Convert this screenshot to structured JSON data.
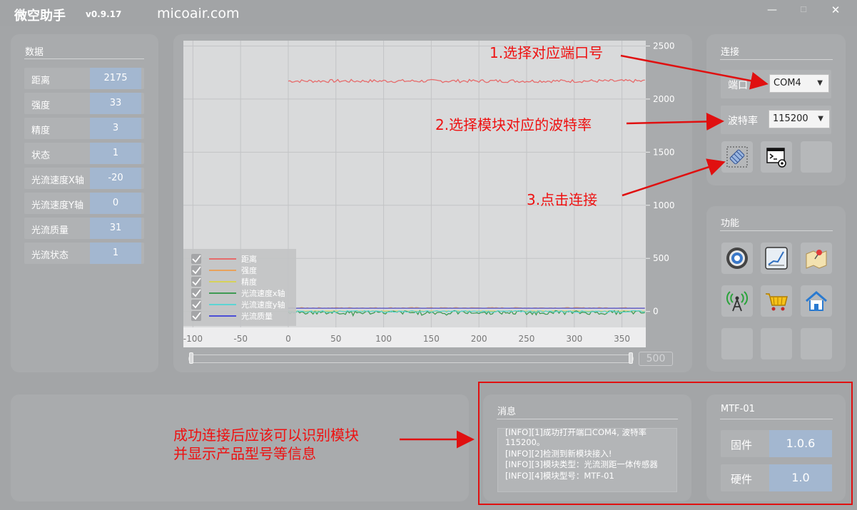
{
  "titlebar": {
    "app_name": "微空助手",
    "version": "v0.9.17",
    "site": "micoair.com",
    "min": "—",
    "max": "☐",
    "close": "✕"
  },
  "data_panel": {
    "title": "数据",
    "rows": [
      {
        "label": "距离",
        "value": "2175"
      },
      {
        "label": "强度",
        "value": "33"
      },
      {
        "label": "精度",
        "value": "3"
      },
      {
        "label": "状态",
        "value": "1"
      },
      {
        "label": "光流速度X轴",
        "value": "-20"
      },
      {
        "label": "光流速度Y轴",
        "value": "0"
      },
      {
        "label": "光流质量",
        "value": "31"
      },
      {
        "label": "光流状态",
        "value": "1"
      }
    ]
  },
  "chart": {
    "slider_value": "500"
  },
  "chart_data": {
    "type": "line",
    "x_ticks": [
      -100,
      -50,
      0,
      50,
      100,
      150,
      200,
      250,
      300,
      350
    ],
    "y_ticks": [
      0,
      500,
      1000,
      1500,
      2000,
      2500
    ],
    "xlim": [
      -110,
      375
    ],
    "ylim": [
      -150,
      2550
    ],
    "grid": true,
    "legend_position": "bottom-left",
    "series": [
      {
        "name": "距离",
        "color": "#e66b6b",
        "x_range": [
          0,
          375
        ],
        "level": 2170,
        "noise": 15
      },
      {
        "name": "强度",
        "color": "#e8a25b",
        "x_range": [
          0,
          375
        ],
        "level": 33,
        "noise": 4
      },
      {
        "name": "精度",
        "color": "#d6d25a",
        "x_range": [
          0,
          375
        ],
        "level": 3,
        "noise": 2
      },
      {
        "name": "光流速度x轴",
        "color": "#3f9a53",
        "x_range": [
          0,
          375
        ],
        "level": -10,
        "noise": 18
      },
      {
        "name": "光流速度y轴",
        "color": "#5cd4d4",
        "x_range": [
          0,
          375
        ],
        "level": 0,
        "noise": 8
      },
      {
        "name": "光流质量",
        "color": "#4b4fd6",
        "x_range": [
          0,
          375
        ],
        "level": 31,
        "noise": 0
      }
    ]
  },
  "conn_panel": {
    "title": "连接",
    "port_label": "端口",
    "port_value": "COM4",
    "baud_label": "波特率",
    "baud_value": "115200",
    "caret": "▼"
  },
  "func_panel": {
    "title": "功能"
  },
  "msg_panel": {
    "title": "消息",
    "lines": [
      "[INFO][1]成功打开端口COM4, 波特率",
      "115200。",
      "[INFO][2]检测到新模块接入!",
      "[INFO][3]模块类型：光流测距一体传感器",
      "[INFO][4]模块型号：MTF-01"
    ]
  },
  "mtf_panel": {
    "title": "MTF-01",
    "firmware_label": "固件",
    "firmware_value": "1.0.6",
    "hardware_label": "硬件",
    "hardware_value": "1.0"
  },
  "annotations": {
    "step1": "1.选择对应端口号",
    "step2": "2.选择模块对应的波特率",
    "step3": "3.点击连接",
    "note_line1": "成功连接后应该可以识别模块",
    "note_line2": "并显示产品型号等信息"
  },
  "colors": {
    "accent_value_bg": "#a3b7d0",
    "annotation_red": "#ee1111"
  }
}
